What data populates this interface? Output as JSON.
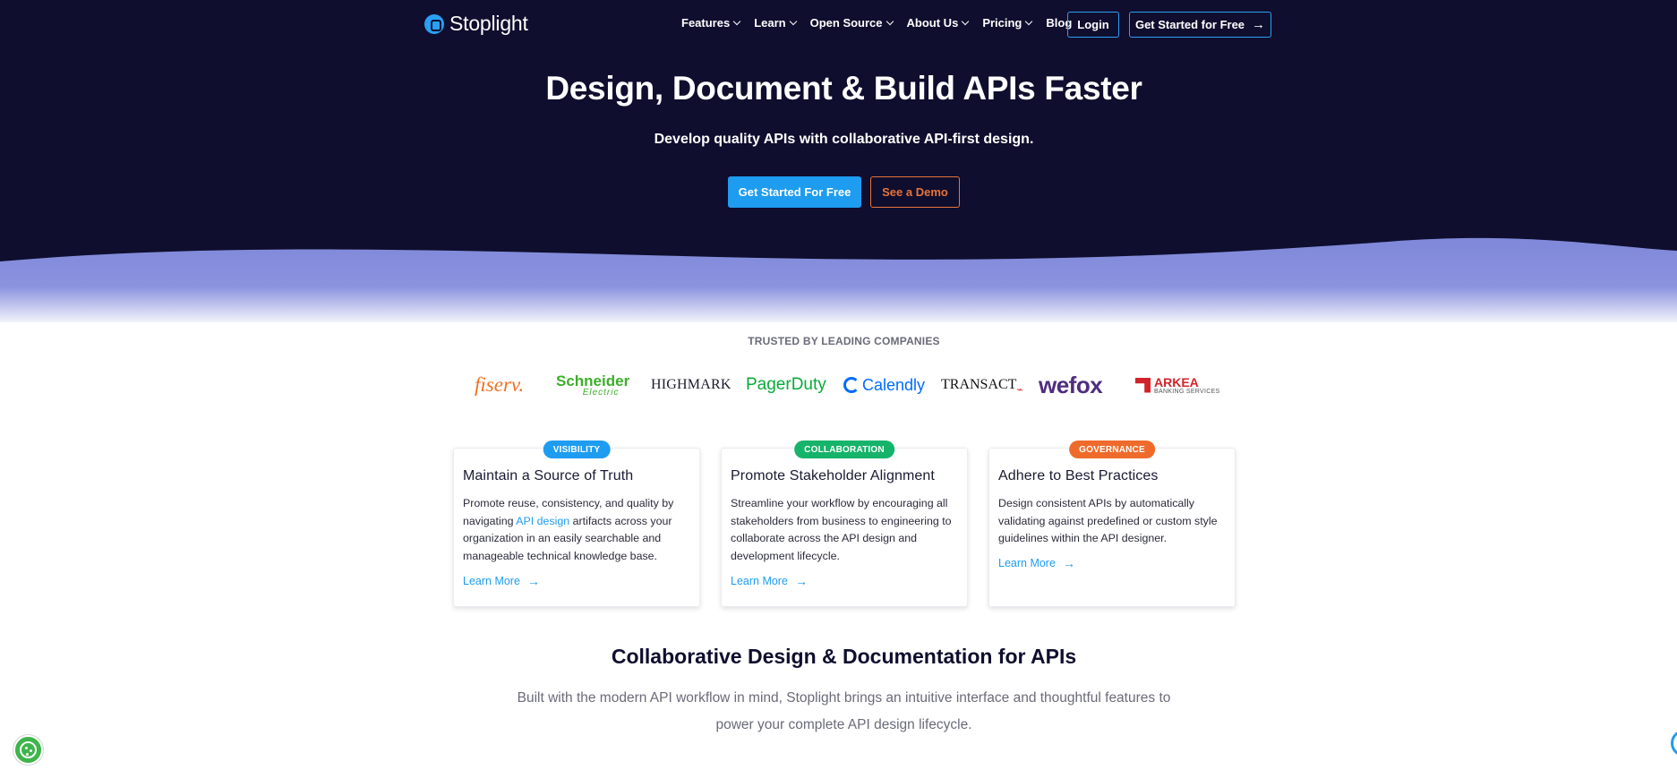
{
  "brand": {
    "name": "Stoplight"
  },
  "nav": {
    "items": [
      {
        "label": "Features"
      },
      {
        "label": "Learn"
      },
      {
        "label": "Open Source"
      },
      {
        "label": "About Us"
      },
      {
        "label": "Pricing"
      },
      {
        "label": "Blog"
      }
    ],
    "login_label": "Login",
    "cta_label": "Get Started for Free"
  },
  "hero": {
    "title": "Design, Document & Build APIs Faster",
    "subtitle": "Develop quality APIs with collaborative API-first design.",
    "primary_button": "Get Started For Free",
    "secondary_button": "See a Demo"
  },
  "trusted": {
    "heading": "TRUSTED BY LEADING COMPANIES",
    "logos": {
      "fiserv": "fiserv.",
      "schneider_a": "Schneider",
      "schneider_b": "Electric",
      "highmark": "HIGHMARK",
      "pagerduty": "PagerDuty",
      "calendly": "Calendly",
      "transact": "TRANSACT",
      "wefox": "wefox",
      "arkea_a": "ARKEA",
      "arkea_b": "BANKING SERVICES"
    }
  },
  "cards": [
    {
      "badge": "VISIBILITY",
      "badge_color": "#1e9cf0",
      "title": "Maintain a Source of Truth",
      "body_before": "Promote reuse, consistency, and quality by navigating ",
      "body_link": "API design",
      "body_after": " artifacts across your organization in an easily searchable and manageable technical knowledge base.",
      "more": "Learn More"
    },
    {
      "badge": "COLLABORATION",
      "badge_color": "#16b36b",
      "title": "Promote Stakeholder Alignment",
      "body": "Streamline your workflow by encouraging all stakeholders from business to engineering to collaborate across the API design and development lifecycle.",
      "more": "Learn More"
    },
    {
      "badge": "GOVERNANCE",
      "badge_color": "#ef6b2c",
      "title": "Adhere to Best Practices",
      "body": "Design consistent APIs by automatically validating against predefined or custom style guidelines within the API designer.",
      "more": "Learn More"
    }
  ],
  "section2": {
    "title": "Collaborative Design & Documentation for APIs",
    "subtitle": "Built with the modern API workflow in mind, Stoplight brings an intuitive interface and thoughtful features to power your complete API design lifecycle."
  },
  "colors": {
    "hero_bg": "#0f0e2e",
    "wave": "#7f88d9",
    "accent": "#1e9cf0",
    "demo_orange": "#e8743b"
  },
  "icons": {
    "logo": "stoplight-logo-icon",
    "chevron": "chevron-down-icon",
    "arrow": "arrow-right-icon",
    "cookie": "cookie-icon",
    "chat": "chat-icon"
  }
}
